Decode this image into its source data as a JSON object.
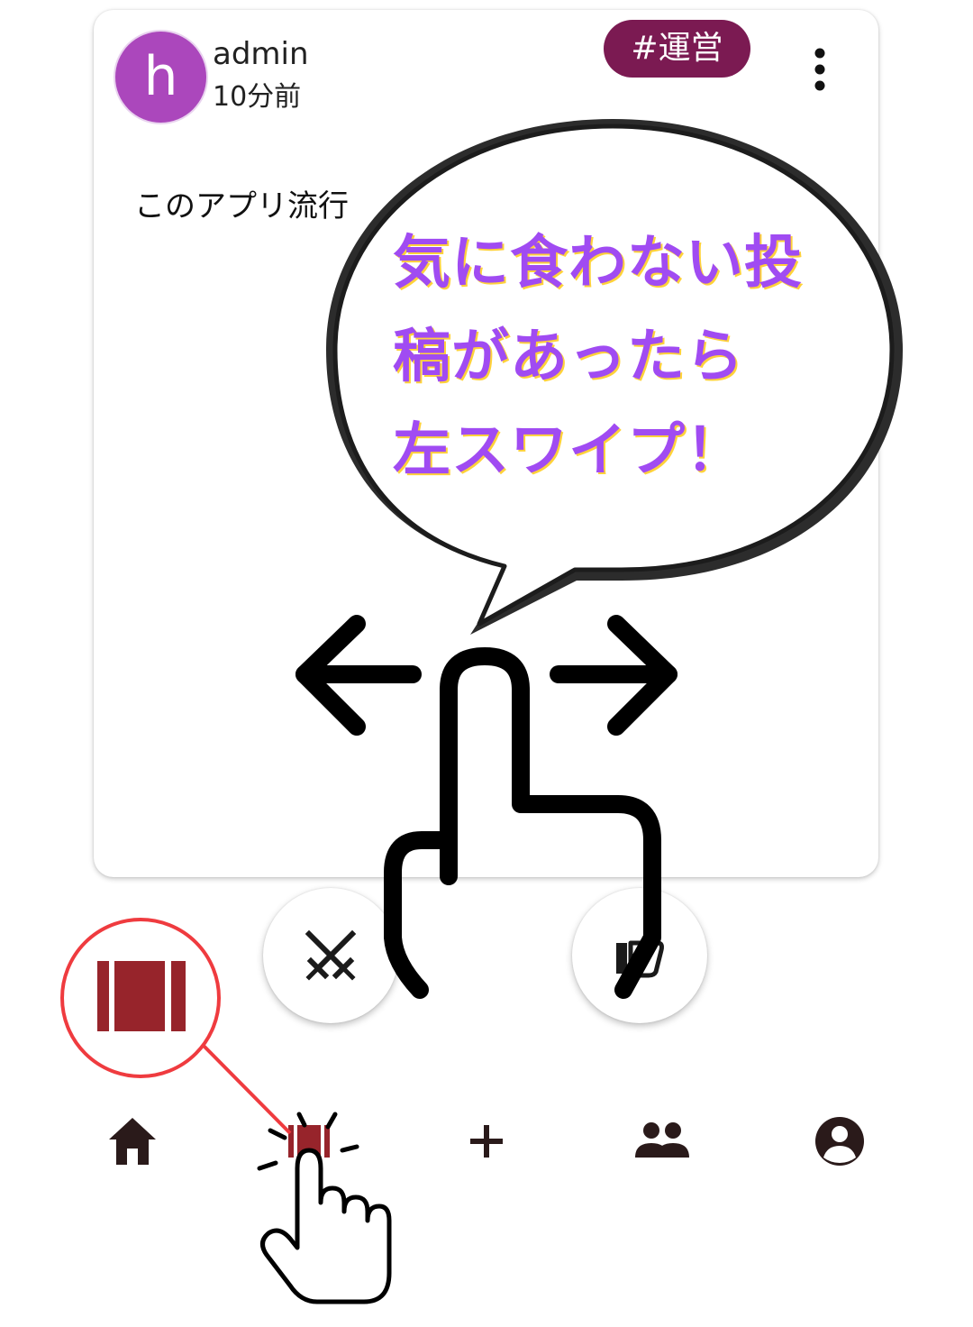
{
  "post": {
    "author": "admin",
    "avatar_letter": "h",
    "time_ago": "10分前",
    "tag": "#運営",
    "body": "このアプリ流行"
  },
  "tutorial": {
    "bubble_lines": [
      "気に食わない投",
      "稿があったら",
      "左スワイプ！"
    ]
  },
  "actions": {
    "left_icon": "crossed-swords-icon",
    "right_icon": "thumbs-down-icon"
  },
  "bottom_nav": {
    "items": [
      {
        "icon": "home-icon"
      },
      {
        "icon": "cards-icon",
        "active": true
      },
      {
        "icon": "plus-icon"
      },
      {
        "icon": "group-icon"
      },
      {
        "icon": "account-icon"
      }
    ]
  },
  "colors": {
    "tag_bg": "#7b1a52",
    "avatar_bg": "#ab47bc",
    "accent_red": "#97242b",
    "highlight_circle": "#ef3b3f",
    "bubble_text": "#a04bf2",
    "bubble_text_shadow": "#ffd23a",
    "nav_icon": "#2a1a1a"
  }
}
